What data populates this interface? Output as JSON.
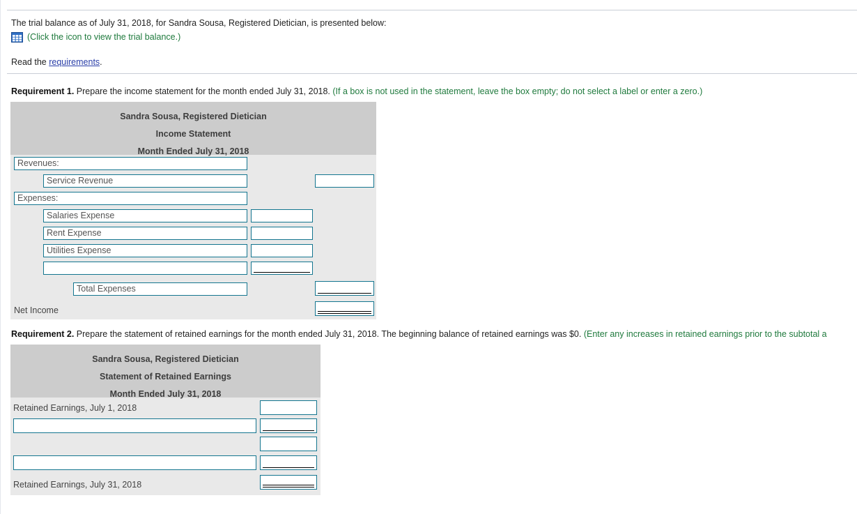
{
  "intro": {
    "line1": "The trial balance as of July 31, 2018, for Sandra Sousa, Registered Dietician, is presented below:",
    "icon_name": "spreadsheet-grid-icon",
    "icon_text": "(Click the icon to view the trial balance.)",
    "read_prefix": "Read the ",
    "read_link": "requirements",
    "read_suffix": "."
  },
  "requirement1": {
    "label": "Requirement 1.",
    "instruction": " Prepare the income statement for the month ended July 31, 2018. ",
    "hint": "(If a box is not used in the statement, leave the box empty; do not select a label or enter a zero.)"
  },
  "requirement2": {
    "label": "Requirement 2.",
    "instruction": " Prepare the statement of retained earnings for the month ended July 31, 2018. The beginning balance of retained earnings was $0. ",
    "hint": "(Enter any increases in retained earnings prior to the subtotal a"
  },
  "income_statement": {
    "title_line1": "Sandra Sousa, Registered Dietician",
    "title_line2": "Income Statement",
    "title_line3": "Month Ended July 31, 2018",
    "rows": {
      "revenues_label": "Revenues:",
      "service_revenue_label": "Service Revenue",
      "service_revenue_amount": "",
      "expenses_label": "Expenses:",
      "salaries_label": "Salaries Expense",
      "salaries_amount": "",
      "rent_label": "Rent Expense",
      "rent_amount": "",
      "utilities_label": "Utilities Expense",
      "utilities_amount": "",
      "blank_label": "",
      "blank_amount": "",
      "total_expenses_label": "Total Expenses",
      "total_expenses_amount": "",
      "net_income_label": "Net Income",
      "net_income_amount": ""
    }
  },
  "retained_statement": {
    "title_line1": "Sandra Sousa, Registered Dietician",
    "title_line2": "Statement of Retained Earnings",
    "title_line3": "Month Ended July 31, 2018",
    "rows": {
      "beginning_label": "Retained Earnings, July 1, 2018",
      "beginning_amount": "",
      "addition_label": "",
      "addition_amount": "",
      "subtotal_amount": "",
      "deduction_label": "",
      "deduction_amount": "",
      "ending_label": "Retained Earnings, July 31, 2018",
      "ending_amount": ""
    }
  },
  "colors": {
    "header_gray": "#cccccc",
    "body_gray": "#e9e9e9",
    "box_border": "#13758f",
    "green_text": "#1f7a3d",
    "link_blue": "#2a3ea8",
    "icon_blue": "#2f6fc4"
  }
}
